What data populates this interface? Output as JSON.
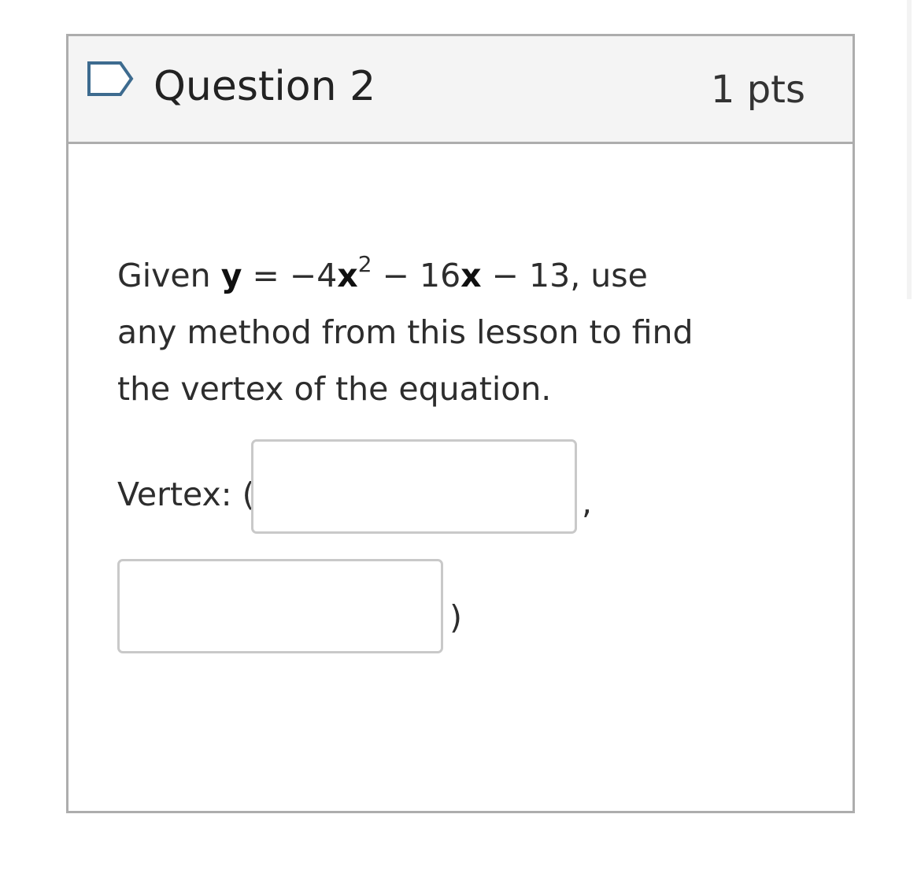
{
  "question": {
    "title": "Question 2",
    "points": "1 pts",
    "flag_icon": "flag-bookmark-icon"
  },
  "body": {
    "given": "Given",
    "y_var": "y",
    "equals": " = −4",
    "x_var1": "x",
    "exponent": "2",
    "minus16": " − 16",
    "x_var2": "x",
    "rest": " − 13, use any method from this lesson to find the vertex of the equation."
  },
  "answer": {
    "vertex_label": "Vertex: (",
    "x_value": "",
    "separator": ",",
    "y_value": "",
    "closing": ")"
  },
  "colors": {
    "header_bg": "#f4f4f4",
    "border": "#adadad",
    "flag_outline": "#3d6b8f"
  }
}
